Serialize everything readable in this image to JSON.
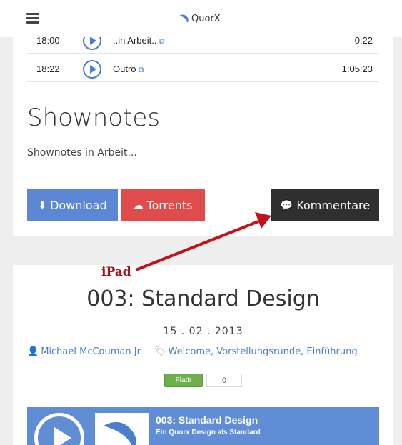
{
  "header": {
    "brand": "QuorX",
    "menu_icon": "hamburger-icon",
    "logo_icon": "quorx-logo-icon"
  },
  "chapters": [
    {
      "time": "18:00",
      "title": "..in Arbeit..",
      "duration": "0:22"
    },
    {
      "time": "18:22",
      "title": "Outro",
      "duration": "1:05:23"
    }
  ],
  "shownotes": {
    "heading": "Shownotes",
    "text": "Shownotes in Arbeit..."
  },
  "actions": {
    "download": "Download",
    "torrents": "Torrents",
    "comments": "Kommentare"
  },
  "annotation": {
    "label": "iPad",
    "color": "#c4121a"
  },
  "episode": {
    "title": "003: Standard Design",
    "date": "15 . 02 . 2013",
    "author": "Michael McCouman Jr.",
    "tags": "Welcome, Vorstellungsrunde, Einführung",
    "flattr_label": "Flattr",
    "flattr_count": "0"
  },
  "player": {
    "title": "003: Standard Design",
    "subtitle": "Ein Quorx Design als Standard"
  },
  "colors": {
    "accent": "#5b87d4",
    "danger": "#e04b4b",
    "dark": "#2f2f2f",
    "flattr": "#6eaf4b"
  }
}
